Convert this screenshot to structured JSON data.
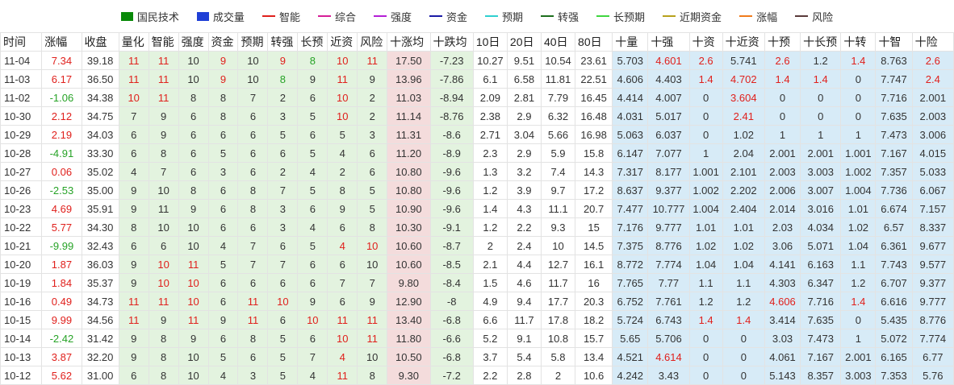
{
  "legend": [
    {
      "label": "国民技术",
      "color": "#0a8a0a",
      "shape": "box"
    },
    {
      "label": "成交量",
      "color": "#1f3fd6",
      "shape": "box"
    },
    {
      "label": "智能",
      "color": "#e0201c",
      "shape": "line"
    },
    {
      "label": "综合",
      "color": "#d61f97",
      "shape": "line"
    },
    {
      "label": "强度",
      "color": "#b41fd6",
      "shape": "line"
    },
    {
      "label": "资金",
      "color": "#1a1aa6",
      "shape": "line"
    },
    {
      "label": "预期",
      "color": "#2fd0d0",
      "shape": "line"
    },
    {
      "label": "转强",
      "color": "#1d6e1d",
      "shape": "line"
    },
    {
      "label": "长预期",
      "color": "#3fd63f",
      "shape": "line"
    },
    {
      "label": "近期资金",
      "color": "#b8a21c",
      "shape": "line"
    },
    {
      "label": "涨幅",
      "color": "#f07b1c",
      "shape": "line"
    },
    {
      "label": "风险",
      "color": "#5a3a3a",
      "shape": "line"
    }
  ],
  "columns": [
    "时间",
    "涨幅",
    "收盘",
    "量化",
    "智能",
    "强度",
    "资金",
    "预期",
    "转强",
    "长预",
    "近资",
    "风险",
    "十涨均",
    "十跌均",
    "10日",
    "20日",
    "40日",
    "80日",
    "十量",
    "十强",
    "十资",
    "十近资",
    "十预",
    "十长预",
    "十转",
    "十智",
    "十险"
  ],
  "rows": [
    [
      "11-04",
      "7.34",
      "39.18",
      "11",
      "11",
      "10",
      "9",
      "10",
      "9",
      "8",
      "10",
      "11",
      "17.50",
      "-7.23",
      "10.27",
      "9.51",
      "10.54",
      "23.61",
      "5.703",
      "4.601",
      "2.6",
      "5.741",
      "2.6",
      "1.2",
      "1.4",
      "8.763",
      "2.6"
    ],
    [
      "11-03",
      "6.17",
      "36.50",
      "11",
      "11",
      "10",
      "9",
      "10",
      "8",
      "9",
      "11",
      "9",
      "13.96",
      "-7.86",
      "6.1",
      "6.58",
      "11.81",
      "22.51",
      "4.606",
      "4.403",
      "1.4",
      "4.702",
      "1.4",
      "1.4",
      "0",
      "7.747",
      "2.4"
    ],
    [
      "11-02",
      "-1.06",
      "34.38",
      "10",
      "11",
      "8",
      "8",
      "7",
      "2",
      "6",
      "10",
      "2",
      "11.03",
      "-8.94",
      "2.09",
      "2.81",
      "7.79",
      "16.45",
      "4.414",
      "4.007",
      "0",
      "3.604",
      "0",
      "0",
      "0",
      "7.716",
      "2.001"
    ],
    [
      "10-30",
      "2.12",
      "34.75",
      "7",
      "9",
      "6",
      "8",
      "6",
      "3",
      "5",
      "10",
      "2",
      "11.14",
      "-8.76",
      "2.38",
      "2.9",
      "6.32",
      "16.48",
      "4.031",
      "5.017",
      "0",
      "2.41",
      "0",
      "0",
      "0",
      "7.635",
      "2.003"
    ],
    [
      "10-29",
      "2.19",
      "34.03",
      "6",
      "9",
      "6",
      "6",
      "6",
      "5",
      "6",
      "5",
      "3",
      "11.31",
      "-8.6",
      "2.71",
      "3.04",
      "5.66",
      "16.98",
      "5.063",
      "6.037",
      "0",
      "1.02",
      "1",
      "1",
      "1",
      "7.473",
      "3.006"
    ],
    [
      "10-28",
      "-4.91",
      "33.30",
      "6",
      "8",
      "6",
      "5",
      "6",
      "6",
      "5",
      "4",
      "6",
      "11.20",
      "-8.9",
      "2.3",
      "2.9",
      "5.9",
      "15.8",
      "6.147",
      "7.077",
      "1",
      "2.04",
      "2.001",
      "2.001",
      "1.001",
      "7.167",
      "4.015"
    ],
    [
      "10-27",
      "0.06",
      "35.02",
      "4",
      "7",
      "6",
      "3",
      "6",
      "2",
      "4",
      "2",
      "6",
      "10.80",
      "-9.6",
      "1.3",
      "3.2",
      "7.4",
      "14.3",
      "7.317",
      "8.177",
      "1.001",
      "2.101",
      "2.003",
      "3.003",
      "1.002",
      "7.357",
      "5.033"
    ],
    [
      "10-26",
      "-2.53",
      "35.00",
      "9",
      "10",
      "8",
      "6",
      "8",
      "7",
      "5",
      "8",
      "5",
      "10.80",
      "-9.6",
      "1.2",
      "3.9",
      "9.7",
      "17.2",
      "8.637",
      "9.377",
      "1.002",
      "2.202",
      "2.006",
      "3.007",
      "1.004",
      "7.736",
      "6.067"
    ],
    [
      "10-23",
      "4.69",
      "35.91",
      "9",
      "11",
      "9",
      "6",
      "8",
      "3",
      "6",
      "9",
      "5",
      "10.90",
      "-9.6",
      "1.4",
      "4.3",
      "11.1",
      "20.7",
      "7.477",
      "10.777",
      "1.004",
      "2.404",
      "2.014",
      "3.016",
      "1.01",
      "6.674",
      "7.157"
    ],
    [
      "10-22",
      "5.77",
      "34.30",
      "8",
      "10",
      "10",
      "6",
      "6",
      "3",
      "4",
      "6",
      "8",
      "10.30",
      "-9.1",
      "1.2",
      "2.2",
      "9.3",
      "15",
      "7.176",
      "9.777",
      "1.01",
      "1.01",
      "2.03",
      "4.034",
      "1.02",
      "6.57",
      "8.337"
    ],
    [
      "10-21",
      "-9.99",
      "32.43",
      "6",
      "6",
      "10",
      "4",
      "7",
      "6",
      "5",
      "4",
      "10",
      "10.60",
      "-8.7",
      "2",
      "2.4",
      "10",
      "14.5",
      "7.375",
      "8.776",
      "1.02",
      "1.02",
      "3.06",
      "5.071",
      "1.04",
      "6.361",
      "9.677"
    ],
    [
      "10-20",
      "1.87",
      "36.03",
      "9",
      "10",
      "11",
      "5",
      "7",
      "7",
      "6",
      "6",
      "10",
      "10.60",
      "-8.5",
      "2.1",
      "4.4",
      "12.7",
      "16.1",
      "8.772",
      "7.774",
      "1.04",
      "1.04",
      "4.141",
      "6.163",
      "1.1",
      "7.743",
      "9.577"
    ],
    [
      "10-19",
      "1.84",
      "35.37",
      "9",
      "10",
      "10",
      "6",
      "6",
      "6",
      "6",
      "7",
      "7",
      "9.80",
      "-8.4",
      "1.5",
      "4.6",
      "11.7",
      "16",
      "7.765",
      "7.77",
      "1.1",
      "1.1",
      "4.303",
      "6.347",
      "1.2",
      "6.707",
      "9.377"
    ],
    [
      "10-16",
      "0.49",
      "34.73",
      "11",
      "11",
      "10",
      "6",
      "11",
      "10",
      "9",
      "6",
      "9",
      "12.90",
      "-8",
      "4.9",
      "9.4",
      "17.7",
      "20.3",
      "6.752",
      "7.761",
      "1.2",
      "1.2",
      "4.606",
      "7.716",
      "1.4",
      "6.616",
      "9.777"
    ],
    [
      "10-15",
      "9.99",
      "34.56",
      "11",
      "9",
      "11",
      "9",
      "11",
      "6",
      "10",
      "11",
      "11",
      "13.40",
      "-6.8",
      "6.6",
      "11.7",
      "17.8",
      "18.2",
      "5.724",
      "6.743",
      "1.4",
      "1.4",
      "3.414",
      "7.635",
      "0",
      "5.435",
      "8.776"
    ],
    [
      "10-14",
      "-2.42",
      "31.42",
      "9",
      "8",
      "9",
      "6",
      "8",
      "5",
      "6",
      "10",
      "11",
      "11.80",
      "-6.6",
      "5.2",
      "9.1",
      "10.8",
      "15.7",
      "5.65",
      "5.706",
      "0",
      "0",
      "3.03",
      "7.473",
      "1",
      "5.072",
      "7.774"
    ],
    [
      "10-13",
      "3.87",
      "32.20",
      "9",
      "8",
      "10",
      "5",
      "6",
      "5",
      "7",
      "4",
      "10",
      "10.50",
      "-6.8",
      "3.7",
      "5.4",
      "5.8",
      "13.4",
      "4.521",
      "4.614",
      "0",
      "0",
      "4.061",
      "7.167",
      "2.001",
      "6.165",
      "6.77"
    ],
    [
      "10-12",
      "5.62",
      "31.00",
      "6",
      "8",
      "10",
      "4",
      "3",
      "5",
      "4",
      "11",
      "8",
      "9.30",
      "-7.2",
      "2.2",
      "2.8",
      "2",
      "10.6",
      "4.242",
      "3.43",
      "0",
      "0",
      "5.143",
      "8.357",
      "3.003",
      "7.353",
      "5.76"
    ]
  ],
  "highlight_red": [
    [
      0,
      3
    ],
    [
      0,
      4
    ],
    [
      0,
      6
    ],
    [
      0,
      8
    ],
    [
      0,
      10
    ],
    [
      0,
      11
    ],
    [
      0,
      19
    ],
    [
      0,
      20
    ],
    [
      0,
      22
    ],
    [
      0,
      24
    ],
    [
      0,
      26
    ],
    [
      1,
      3
    ],
    [
      1,
      4
    ],
    [
      1,
      6
    ],
    [
      1,
      10
    ],
    [
      1,
      20
    ],
    [
      1,
      21
    ],
    [
      1,
      22
    ],
    [
      1,
      23
    ],
    [
      1,
      26
    ],
    [
      2,
      3
    ],
    [
      2,
      4
    ],
    [
      2,
      10
    ],
    [
      2,
      21
    ],
    [
      3,
      10
    ],
    [
      3,
      21
    ],
    [
      10,
      10
    ],
    [
      10,
      11
    ],
    [
      11,
      4
    ],
    [
      11,
      5
    ],
    [
      12,
      4
    ],
    [
      12,
      5
    ],
    [
      13,
      3
    ],
    [
      13,
      4
    ],
    [
      13,
      5
    ],
    [
      13,
      7
    ],
    [
      13,
      8
    ],
    [
      13,
      22
    ],
    [
      13,
      24
    ],
    [
      14,
      3
    ],
    [
      14,
      5
    ],
    [
      14,
      7
    ],
    [
      14,
      9
    ],
    [
      14,
      10
    ],
    [
      14,
      11
    ],
    [
      14,
      20
    ],
    [
      14,
      21
    ],
    [
      15,
      10
    ],
    [
      15,
      11
    ],
    [
      16,
      10
    ],
    [
      16,
      19
    ],
    [
      17,
      10
    ]
  ],
  "highlight_green": [
    [
      0,
      9
    ],
    [
      1,
      8
    ]
  ],
  "colors": {
    "green_zone": "#e3f3df",
    "pink_zone": "#f4dcdc",
    "blue_zone": "#d7ebf7",
    "positive": "#e0201c",
    "negative": "#27a327"
  }
}
